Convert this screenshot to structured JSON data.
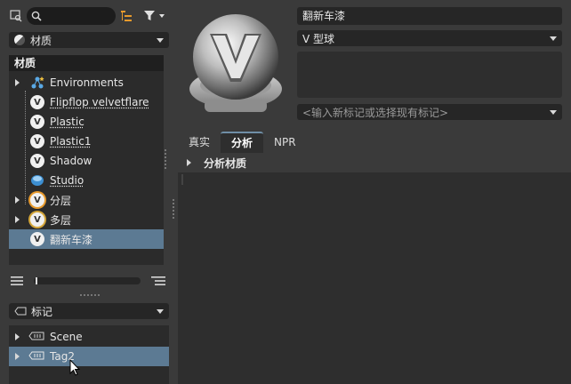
{
  "left": {
    "search": {
      "placeholder": ""
    },
    "library_dropdown": {
      "label": "材质"
    },
    "tree": {
      "header": "材质",
      "items": [
        {
          "label": "Environments",
          "expandable": true,
          "icon": "environments-icon"
        },
        {
          "label": "Flipflop velvetflare",
          "expandable": false,
          "icon": "v-material-icon"
        },
        {
          "label": "Plastic",
          "expandable": false,
          "icon": "v-material-icon"
        },
        {
          "label": "Plastic1",
          "expandable": false,
          "icon": "v-material-icon"
        },
        {
          "label": "Shadow",
          "expandable": false,
          "icon": "v-material-icon"
        },
        {
          "label": "Studio",
          "expandable": false,
          "icon": "studio-icon"
        },
        {
          "label": "分层",
          "expandable": true,
          "icon": "layered-icon"
        },
        {
          "label": "多层",
          "expandable": true,
          "icon": "multilayer-icon"
        },
        {
          "label": "翻新车漆",
          "expandable": false,
          "icon": "v-material-icon",
          "selected": true
        }
      ]
    },
    "tags_dropdown": {
      "label": "标记"
    },
    "tags": [
      {
        "label": "Scene"
      },
      {
        "label": "Tag2",
        "selected": true
      }
    ]
  },
  "right": {
    "material_name": "翻新车漆",
    "material_type": "V 型球",
    "tag_input_placeholder": "<输入新标记或选择现有标记>",
    "tabs": [
      {
        "label": "真实",
        "active": false
      },
      {
        "label": "分析",
        "active": true
      },
      {
        "label": "NPR",
        "active": false
      }
    ],
    "section_title": "分析材质"
  },
  "colors": {
    "background": "#3a3a3a",
    "panel": "#2b2b2b",
    "selection": "#5c7a93",
    "accent": "#e89a2c"
  }
}
